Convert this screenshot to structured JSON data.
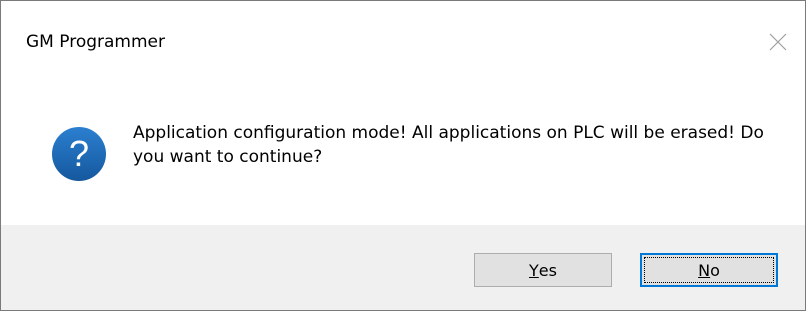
{
  "window": {
    "title": "GM Programmer",
    "close_icon": "close-icon"
  },
  "message": {
    "icon": "question-icon",
    "icon_color": "#1c68b4",
    "text": "Application configuration mode! All applications on PLC will be erased! Do you want to continue?"
  },
  "buttons": {
    "yes": {
      "accel": "Y",
      "rest": "es"
    },
    "no": {
      "accel": "N",
      "rest": "o"
    },
    "focused": "no",
    "focus_color": "#0078d7"
  }
}
